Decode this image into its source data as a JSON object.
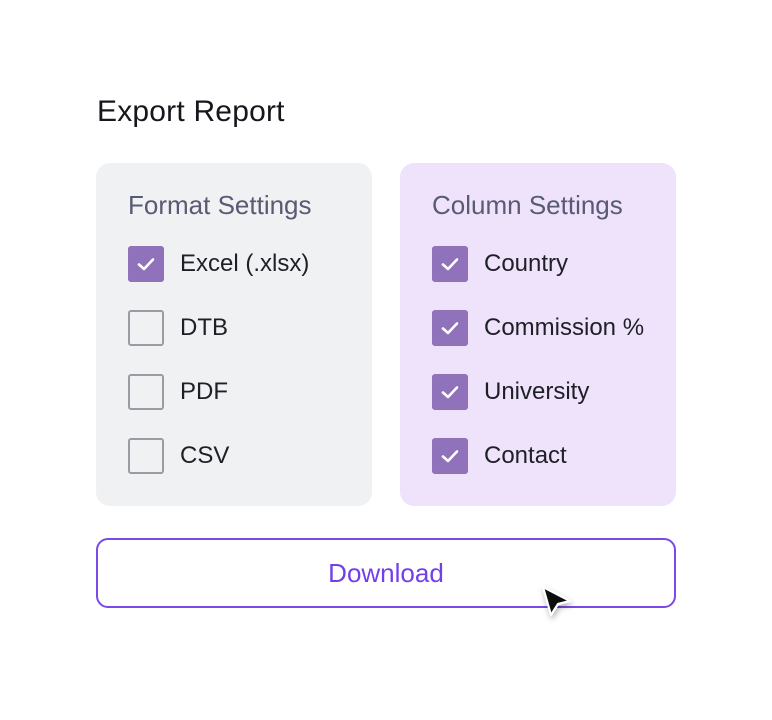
{
  "title": "Export Report",
  "format_settings": {
    "title": "Format Settings",
    "options": [
      {
        "label": "Excel (.xlsx)",
        "checked": true
      },
      {
        "label": "DTB",
        "checked": false
      },
      {
        "label": "PDF",
        "checked": false
      },
      {
        "label": "CSV",
        "checked": false
      }
    ]
  },
  "column_settings": {
    "title": "Column Settings",
    "options": [
      {
        "label": "Country",
        "checked": true
      },
      {
        "label": "Commission %",
        "checked": true
      },
      {
        "label": "University",
        "checked": true
      },
      {
        "label": "Contact",
        "checked": true
      }
    ]
  },
  "download_button": {
    "label": "Download"
  },
  "icons": {
    "checkmark": "check-icon",
    "cursor": "mouse-pointer-icon"
  },
  "colors": {
    "accent": "#7a49e6",
    "checkbox_checked": "#8f72b9",
    "format_panel_bg": "#f0f1f3",
    "column_panel_bg": "#efe3fc"
  }
}
